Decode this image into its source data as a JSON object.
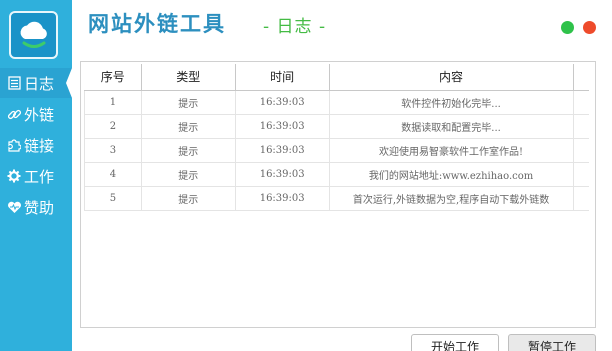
{
  "header": {
    "title": "网站外链工具",
    "subtitle": "- 日志 -"
  },
  "sidebar": {
    "items": [
      {
        "label": "日志",
        "icon": "log-icon",
        "active": true
      },
      {
        "label": "外链",
        "icon": "link-icon",
        "active": false
      },
      {
        "label": "链接",
        "icon": "puzzle-icon",
        "active": false
      },
      {
        "label": "工作",
        "icon": "gear-icon",
        "active": false
      },
      {
        "label": "赞助",
        "icon": "heart-icon",
        "active": false
      }
    ]
  },
  "log_table": {
    "columns": [
      "序号",
      "类型",
      "时间",
      "内容"
    ],
    "rows": [
      {
        "index": "1",
        "type": "提示",
        "time": "16:39:03",
        "content": "软件控件初始化完毕..."
      },
      {
        "index": "2",
        "type": "提示",
        "time": "16:39:03",
        "content": "数据读取和配置完毕..."
      },
      {
        "index": "3",
        "type": "提示",
        "time": "16:39:03",
        "content": "欢迎使用易智豪软件工作室作品!"
      },
      {
        "index": "4",
        "type": "提示",
        "time": "16:39:03",
        "content": "我们的网站地址:www.ezhihao.com"
      },
      {
        "index": "5",
        "type": "提示",
        "time": "16:39:03",
        "content": "首次运行,外链数据为空,程序自动下载外链数"
      }
    ]
  },
  "buttons": {
    "start": "开始工作",
    "stop": "暂停工作"
  },
  "colors": {
    "sidebar": "#2fb0dc",
    "title": "#2c8fbf",
    "subtitle": "#44bb44",
    "dot_green": "#2fc24a",
    "dot_red": "#ee4b2b"
  }
}
